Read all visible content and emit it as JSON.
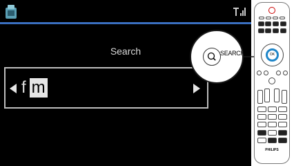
{
  "screen": {
    "title": "Search",
    "entry": {
      "entered_char": "f",
      "cursor_char": "m"
    },
    "icons": {
      "device": "device-icon",
      "signal": "signal-strength-icon",
      "left": "arrow-left-icon",
      "right": "arrow-right-icon"
    },
    "accent_color": "#3a6fc0"
  },
  "callout": {
    "search_label": "SEARCH",
    "button_icon": "search-icon",
    "ok_label": "OK"
  },
  "remote": {
    "brand": "PHILIPS"
  }
}
